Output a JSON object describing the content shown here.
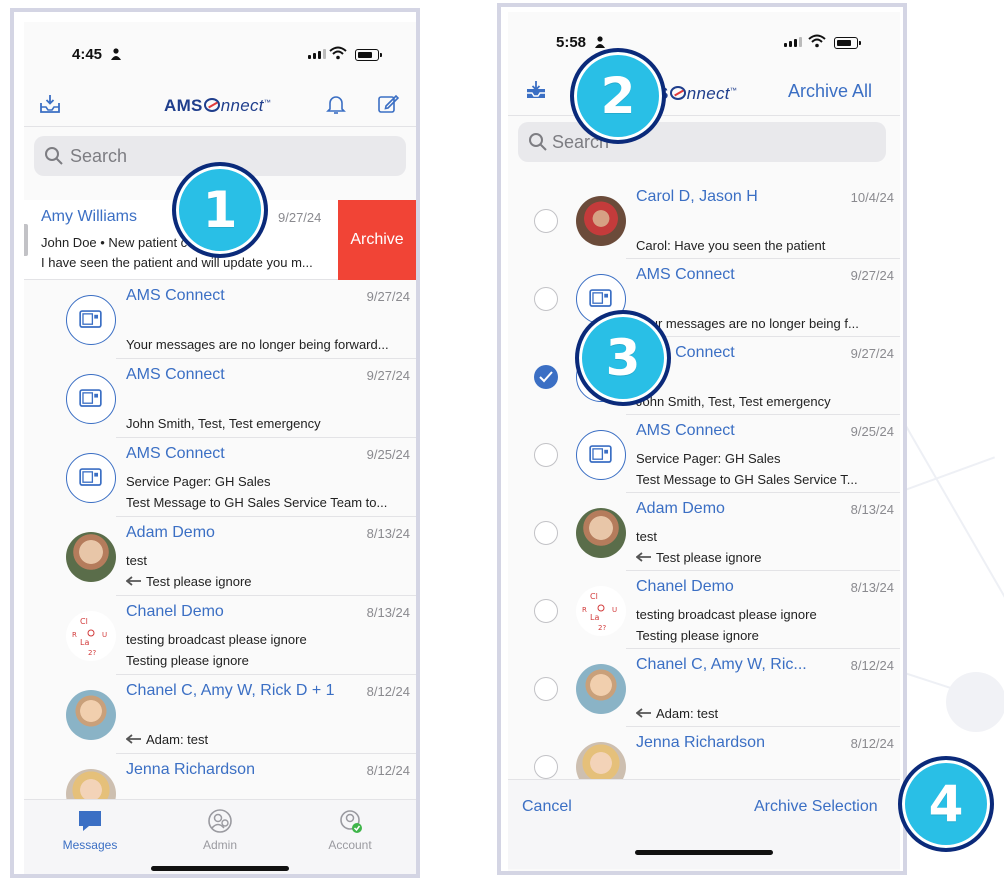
{
  "colors": {
    "accent": "#3b6fc4",
    "archive_red": "#f14436",
    "badge_fill": "#29bfe6",
    "badge_ring": "#0b2a7a",
    "brand_navy": "#1f3e8c"
  },
  "brand": {
    "prefix": "AMS",
    "suffix": "nnect",
    "mark": "™"
  },
  "left": {
    "time": "4:45",
    "search_placeholder": "Search",
    "swiped_row": {
      "name": "Amy Williams",
      "date": "9/27/24",
      "line1": "John Doe • New patient consult",
      "line2": "I have seen the patient and will update you m...",
      "action_label": "Archive"
    },
    "rows": [
      {
        "name": "AMS Connect",
        "date": "9/27/24",
        "line1": "",
        "line2": "Your messages are no longer being forward...",
        "avatar": "system-icon",
        "reply": false
      },
      {
        "name": "AMS Connect",
        "date": "9/27/24",
        "line1": "",
        "line2": "John Smith, Test, Test emergency",
        "avatar": "system-icon",
        "reply": false
      },
      {
        "name": "AMS Connect",
        "date": "9/25/24",
        "line1": "Service Pager: GH Sales",
        "line2": "Test Message to GH Sales Service Team to...",
        "avatar": "system-icon",
        "reply": false
      },
      {
        "name": "Adam Demo",
        "date": "8/13/24",
        "line1": "test",
        "line2": "Test please ignore",
        "avatar": "photo-a",
        "reply": true
      },
      {
        "name": "Chanel Demo",
        "date": "8/13/24",
        "line1": "testing broadcast please ignore",
        "line2": "Testing please ignore",
        "avatar": "doodle",
        "reply": false
      },
      {
        "name": "Chanel C, Amy W, Rick D + 1",
        "date": "8/12/24",
        "line1": "",
        "line2": "Adam: test",
        "avatar": "photo-b",
        "reply": true
      },
      {
        "name": "Jenna Richardson",
        "date": "8/12/24",
        "line1": "",
        "line2": "",
        "avatar": "photo-c",
        "reply": false
      }
    ],
    "tabs": [
      {
        "label": "Messages",
        "icon": "chat-bubble-icon",
        "active": true
      },
      {
        "label": "Admin",
        "icon": "admin-icon",
        "active": false
      },
      {
        "label": "Account",
        "icon": "account-icon",
        "active": false
      }
    ]
  },
  "right": {
    "time": "5:58",
    "archive_all_label": "Archive All",
    "search_placeholder": "Search",
    "rows": [
      {
        "name": "Carol D, Jason H",
        "date": "10/4/24",
        "line1": "",
        "line2": "Carol: Have you seen the patient",
        "avatar": "photo-d",
        "checked": false,
        "reply": false
      },
      {
        "name": "AMS Connect",
        "date": "9/27/24",
        "line1": "",
        "line2": "Your messages are no longer being f...",
        "avatar": "system-icon",
        "checked": false,
        "reply": false
      },
      {
        "name": "AMS Connect",
        "date": "9/27/24",
        "line1": "",
        "line2": "John Smith, Test, Test emergency",
        "avatar": "system-icon",
        "checked": true,
        "reply": false
      },
      {
        "name": "AMS Connect",
        "date": "9/25/24",
        "line1": "Service Pager: GH Sales",
        "line2": "Test Message to GH Sales Service T...",
        "avatar": "system-icon",
        "checked": false,
        "reply": false
      },
      {
        "name": "Adam Demo",
        "date": "8/13/24",
        "line1": "test",
        "line2": "Test please ignore",
        "avatar": "photo-a",
        "checked": false,
        "reply": true
      },
      {
        "name": "Chanel Demo",
        "date": "8/13/24",
        "line1": "testing broadcast please ignore",
        "line2": "Testing please ignore",
        "avatar": "doodle",
        "checked": false,
        "reply": false
      },
      {
        "name": "Chanel C, Amy W, Ric...",
        "date": "8/12/24",
        "line1": "",
        "line2": "Adam: test",
        "avatar": "photo-b",
        "checked": false,
        "reply": true
      },
      {
        "name": "Jenna Richardson",
        "date": "8/12/24",
        "line1": "",
        "line2": "",
        "avatar": "photo-c",
        "checked": false,
        "reply": false
      }
    ],
    "cancel_label": "Cancel",
    "archive_selection_label": "Archive Selection"
  },
  "badges": [
    "1",
    "2",
    "3",
    "4"
  ]
}
